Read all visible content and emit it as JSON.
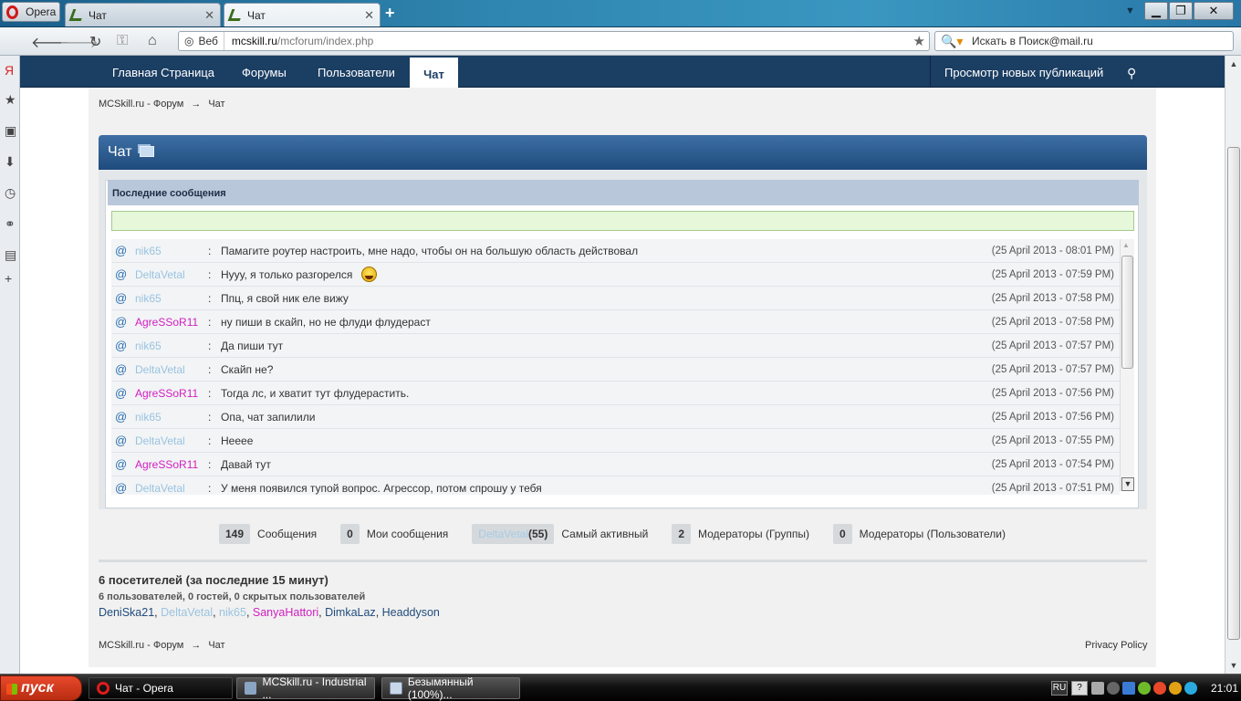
{
  "browser": {
    "menu_label": "Opera",
    "tabs": [
      {
        "label": "Чат"
      },
      {
        "label": "Чат"
      }
    ],
    "address_scheme_label": "Веб",
    "url_host": "mcskill.ru",
    "url_path": "/mcforum/index.php",
    "search_placeholder": "Искать в Поиск@mail.ru"
  },
  "site": {
    "nav": [
      "Главная Страница",
      "Форумы",
      "Пользователи",
      "Чат"
    ],
    "nav_right": "Просмотр новых публикаций",
    "breadcrumb": {
      "root": "MCSkill.ru - Форум",
      "arrow": "→",
      "current": "Чат"
    }
  },
  "chat": {
    "title": "Чат",
    "section_header": "Последние сообщения",
    "messages": [
      {
        "user": "nik65",
        "color": "#9ac3e0",
        "text": "Памагите роутер настроить, мне надо, чтобы он на большую область действовал",
        "time": "(25 April 2013 - 08:01 PM)"
      },
      {
        "user": "DeltaVetal",
        "color": "#9ac3e0",
        "text": "Нууу, я только разгорелся",
        "time": "(25 April 2013 - 07:59 PM)",
        "smiley": true
      },
      {
        "user": "nik65",
        "color": "#9ac3e0",
        "text": "Ппц, я свой ник еле вижу",
        "time": "(25 April 2013 - 07:58 PM)"
      },
      {
        "user": "AgreSSoR11",
        "color": "#d21ec0",
        "text": "ну пиши в скайп, но не флуди флудераст",
        "time": "(25 April 2013 - 07:58 PM)"
      },
      {
        "user": "nik65",
        "color": "#9ac3e0",
        "text": "Да пиши тут",
        "time": "(25 April 2013 - 07:57 PM)"
      },
      {
        "user": "DeltaVetal",
        "color": "#9ac3e0",
        "text": "Скайп не?",
        "time": "(25 April 2013 - 07:57 PM)"
      },
      {
        "user": "AgreSSoR11",
        "color": "#d21ec0",
        "text": "Тогда лс, и хватит тут флудерастить.",
        "time": "(25 April 2013 - 07:56 PM)"
      },
      {
        "user": "nik65",
        "color": "#9ac3e0",
        "text": "Опа, чат запилили",
        "time": "(25 April 2013 - 07:56 PM)"
      },
      {
        "user": "DeltaVetal",
        "color": "#9ac3e0",
        "text": "Нееее",
        "time": "(25 April 2013 - 07:55 PM)"
      },
      {
        "user": "AgreSSoR11",
        "color": "#d21ec0",
        "text": "Давай тут",
        "time": "(25 April 2013 - 07:54 PM)"
      },
      {
        "user": "DeltaVetal",
        "color": "#9ac3e0",
        "text": "У меня появился тупой вопрос. Агрессор, потом спрошу у тебя",
        "time": "(25 April 2013 - 07:51 PM)"
      }
    ],
    "stats": [
      {
        "count": "149",
        "label": "Сообщения"
      },
      {
        "count": "0",
        "label": "Мои сообщения"
      },
      {
        "name": "DeltaVetal",
        "count": "(55)",
        "label": "Самый активный"
      },
      {
        "count": "2",
        "label": "Модераторы (Группы)"
      },
      {
        "count": "0",
        "label": "Модераторы (Пользователи)"
      }
    ]
  },
  "visitors": {
    "title": "6 посетителей (за последние 15 минут)",
    "subtitle": "6 пользователей, 0 гостей, 0 скрытых пользователей",
    "users": [
      {
        "name": "DeniSka21",
        "color": "#1f4b7c"
      },
      {
        "name": "DeltaVetal",
        "color": "#9ac3e0"
      },
      {
        "name": "nik65",
        "color": "#9ac3e0"
      },
      {
        "name": "SanyaHattori",
        "color": "#d21ec0"
      },
      {
        "name": "DimkaLaz",
        "color": "#1f4b7c"
      },
      {
        "name": "Headdyson",
        "color": "#1f4b7c"
      }
    ]
  },
  "footer": {
    "privacy": "Privacy Policy"
  },
  "taskbar": {
    "start_label": "пуск",
    "items": [
      {
        "label": "Чат - Opera"
      },
      {
        "label": "MCSkill.ru - Industrial ..."
      },
      {
        "label": "Безымянный (100%)..."
      }
    ],
    "lang": "RU",
    "clock": "21:01"
  },
  "icons": [
    "opera-icon",
    "back-icon",
    "forward-icon",
    "reload-icon",
    "key-icon",
    "home-icon",
    "globe-icon",
    "star-icon",
    "search-icon",
    "location-pin-icon",
    "chat-icon",
    "smiley-icon"
  ]
}
